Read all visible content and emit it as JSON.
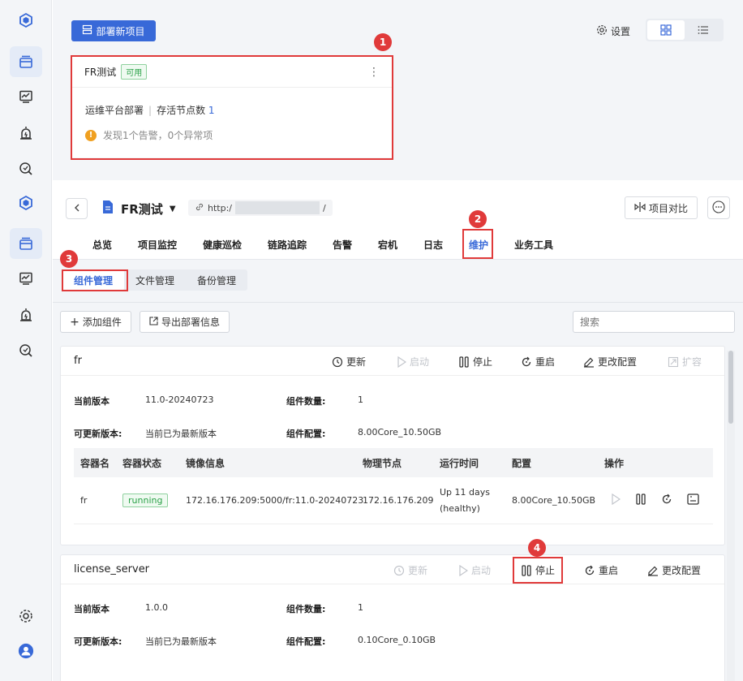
{
  "sidebar": {
    "icons": [
      "cube-logo-icon",
      "window-stack-icon",
      "monitor-chart-icon",
      "alarm-icon",
      "search-shield-icon"
    ],
    "bottom_icons": [
      "gear-icon",
      "user-avatar-icon"
    ]
  },
  "top": {
    "deploy_label": "部署新项目",
    "settings_label": "设置",
    "card": {
      "title": "FR测试",
      "status": "可用",
      "platform": "运维平台部署",
      "nodes_label": "存活节点数",
      "nodes_count": "1",
      "warning": "发现1个告警，0个异常项"
    }
  },
  "markers": [
    "1",
    "2",
    "3",
    "4"
  ],
  "detail": {
    "title": "FR测试",
    "url_prefix": "http:/",
    "url_suffix": "/",
    "compare_label": "项目对比",
    "tabs": [
      "总览",
      "项目监控",
      "健康巡检",
      "链路追踪",
      "告警",
      "宕机",
      "日志",
      "维护",
      "业务工具"
    ],
    "subtabs": [
      "组件管理",
      "文件管理",
      "备份管理"
    ]
  },
  "toolbar": {
    "add_label": "添加组件",
    "export_label": "导出部署信息",
    "search_placeholder": "搜索"
  },
  "components": [
    {
      "name": "fr",
      "actions": [
        "更新",
        "启动",
        "停止",
        "重启",
        "更改配置",
        "扩容"
      ],
      "current_version_label": "当前版本",
      "current_version": "11.0-20240723",
      "count_label": "组件数量:",
      "count": "1",
      "updatable_label": "可更新版本:",
      "updatable": "当前已为最新版本",
      "config_label": "组件配置:",
      "config": "8.00Core_10.50GB",
      "table_headers": [
        "容器名",
        "容器状态",
        "镜像信息",
        "物理节点",
        "运行时间",
        "配置",
        "操作"
      ],
      "rows": [
        {
          "container": "fr",
          "status": "running",
          "image": "172.16.176.209:5000/fr:11.0-20240723",
          "node": "172.16.176.209",
          "uptime_1": "Up 11 days",
          "uptime_2": "(healthy)",
          "config": "8.00Core_10.50GB"
        }
      ]
    },
    {
      "name": "license_server",
      "actions": [
        "更新",
        "启动",
        "停止",
        "重启",
        "更改配置"
      ],
      "current_version_label": "当前版本",
      "current_version": "1.0.0",
      "count_label": "组件数量:",
      "count": "1",
      "updatable_label": "可更新版本:",
      "updatable": "当前已为最新版本",
      "config_label": "组件配置:",
      "config": "0.10Core_0.10GB"
    }
  ]
}
